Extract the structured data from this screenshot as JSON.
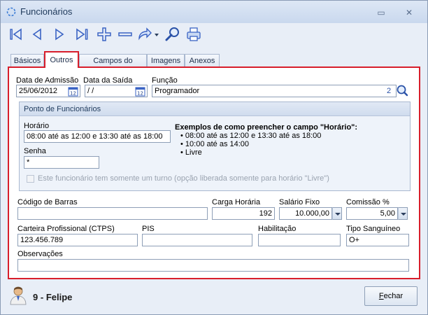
{
  "window": {
    "title": "Funcionários",
    "minimize": "▭",
    "close": "✕"
  },
  "toolbar": [
    "first-icon",
    "prev-icon",
    "next-icon",
    "last-icon",
    "add-icon",
    "remove-icon",
    "refresh-icon",
    "search-icon",
    "print-icon"
  ],
  "tabs": [
    {
      "label": "Básicos",
      "active": false
    },
    {
      "label": "Outros",
      "active": true
    },
    {
      "label": "Campos do Usuário",
      "active": false
    },
    {
      "label": "Imagens",
      "active": false
    },
    {
      "label": "Anexos",
      "active": false
    }
  ],
  "form": {
    "admissao_label": "Data de Admissão",
    "admissao_value": "25/06/2012",
    "saida_label": "Data da Saída",
    "saida_value": " / /",
    "funcao_label": "Função",
    "funcao_value": "Programador",
    "funcao_code": "2",
    "ponto": {
      "title": "Ponto de Funcionários",
      "horario_label": "Horário",
      "horario_value": "08:00 até as 12:00 e 13:30 até as 18:00",
      "senha_label": "Senha",
      "senha_value": "*",
      "examples_title": "Exemplos de como preencher o campo \"Horário\":",
      "examples": [
        "• 08:00 até as 12:00 e 13:30 até as 18:00",
        "• 10:00 até as 14:00",
        "• Livre"
      ],
      "turno_label": "Este funcionário tem somente um turno (opção liberada somente para horário \"Livre\")"
    },
    "codigo_barras_label": "Código de Barras",
    "codigo_barras_value": "",
    "carga_label": "Carga Horária",
    "carga_value": "192",
    "salario_label": "Salário Fixo",
    "salario_value": "10.000,00",
    "comissao_label": "Comissão %",
    "comissao_value": "5,00",
    "ctps_label": "Carteira Profissional (CTPS)",
    "ctps_value": "123.456.789",
    "pis_label": "PIS",
    "pis_value": "",
    "habilitacao_label": "Habilitação",
    "habilitacao_value": "",
    "sangue_label": "Tipo Sanguíneo",
    "sangue_value": "O+",
    "obs_label": "Observações",
    "obs_value": ""
  },
  "footer": {
    "user_id": "9",
    "user_sep": "-",
    "user_name": "Felipe",
    "close_label_first": "F",
    "close_label_rest": "echar"
  },
  "colors": {
    "accent": "#d81e2b",
    "toolbar_icon": "#3a63c4"
  }
}
